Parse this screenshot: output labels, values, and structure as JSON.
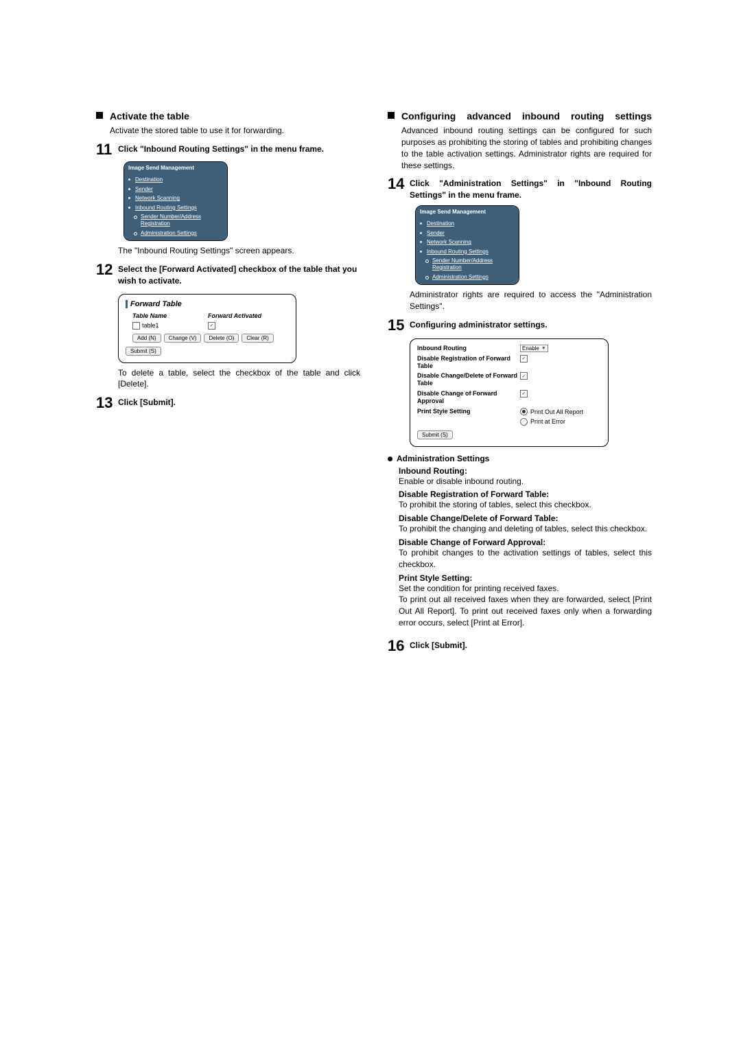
{
  "left": {
    "activate": {
      "title": "Activate the table",
      "desc": "Activate the stored table to use it for forwarding."
    },
    "step11": {
      "num": "11",
      "title": "Click \"Inbound Routing Settings\" in the menu frame.",
      "after": "The \"Inbound Routing Settings\" screen appears."
    },
    "step12": {
      "num": "12",
      "title": "Select the [Forward Activated] checkbox of the table that you wish to activate.",
      "after": "To delete a table, select the checkbox of the table and click [Delete]."
    },
    "step13": {
      "num": "13",
      "title": "Click [Submit]."
    },
    "ism": {
      "head": "Image Send Management",
      "items": [
        "Destination",
        "Sender",
        "Network Scanning",
        "Inbound Routing Settings"
      ],
      "subitems": [
        "Sender Number/Address Registration",
        "Administration Settings"
      ]
    },
    "fwd": {
      "title": "Forward Table",
      "col_name": "Table Name",
      "col_act": "Forward Activated",
      "row_name": "table1",
      "btn_add": "Add (N)",
      "btn_change": "Change (V)",
      "btn_delete": "Delete (O)",
      "btn_clear": "Clear (R)",
      "btn_submit": "Submit (S)"
    }
  },
  "right": {
    "configuring": {
      "title": "Configuring advanced inbound routing settings",
      "desc": "Advanced inbound routing settings can be configured for such purposes as prohibiting the storing of tables and prohibiting changes to the table activation settings. Administrator rights are required for these settings."
    },
    "step14": {
      "num": "14",
      "title": "Click \"Administration Settings\" in \"Inbound Routing Settings\" in the menu frame.",
      "after": "Administrator rights are required to access the \"Administration Settings\"."
    },
    "step15": {
      "num": "15",
      "title": "Configuring administrator settings."
    },
    "step16": {
      "num": "16",
      "title": "Click [Submit]."
    },
    "ism": {
      "head": "Image Send Management",
      "items": [
        "Destination",
        "Sender",
        "Network Scanning",
        "Inbound Routing Settings"
      ],
      "subitems": [
        "Sender Number/Address Registration",
        "Administration Settings"
      ]
    },
    "admin_panel": {
      "inbound_routing": "Inbound Routing",
      "inbound_routing_val": "Enable",
      "disable_reg": "Disable Registration of Forward Table",
      "disable_change_del": "Disable Change/Delete of Forward Table",
      "disable_change_appr": "Disable Change of Forward Approval",
      "print_style": "Print Style Setting",
      "radio_all": "Print Out All Report",
      "radio_err": "Print at Error",
      "btn_submit": "Submit (S)"
    },
    "admin_settings": {
      "head": "Administration Settings",
      "items": [
        {
          "title": "Inbound Routing:",
          "desc": "Enable or disable inbound routing."
        },
        {
          "title": "Disable Registration of Forward Table:",
          "desc": "To prohibit the storing of tables, select this checkbox."
        },
        {
          "title": "Disable Change/Delete of Forward Table:",
          "desc": "To prohibit the changing and deleting of tables, select this checkbox."
        },
        {
          "title": "Disable Change of Forward Approval:",
          "desc": "To prohibit changes to the activation settings of tables, select this checkbox."
        },
        {
          "title": "Print Style Setting:",
          "desc": "Set the condition for printing received faxes.\nTo print out all received faxes when they are forwarded, select [Print Out All Report]. To print out received faxes only when a forwarding error occurs, select [Print at Error]."
        }
      ]
    }
  }
}
